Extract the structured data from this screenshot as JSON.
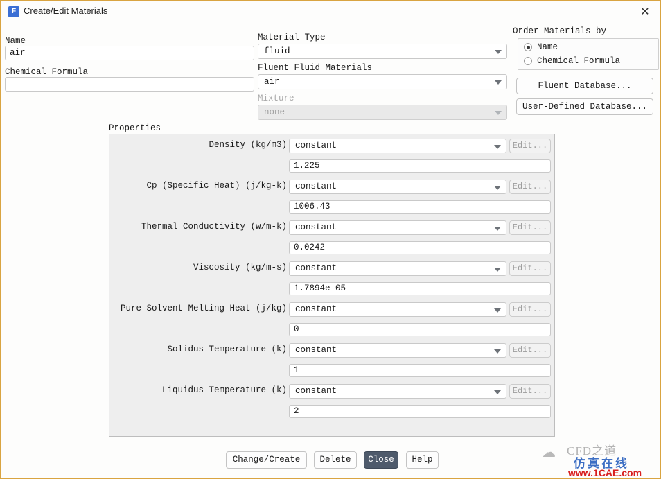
{
  "window": {
    "title": "Create/Edit Materials",
    "icon": "fluent-logo-icon",
    "icon_letter": "F",
    "close_label": "✕",
    "border_color": "#d9a441"
  },
  "left": {
    "name_label": "Name",
    "name_value": "air",
    "chemical_formula_label": "Chemical Formula",
    "chemical_formula_value": ""
  },
  "middle": {
    "material_type_label": "Material Type",
    "material_type_value": "fluid",
    "fluent_fluid_materials_label": "Fluent Fluid Materials",
    "fluent_fluid_materials_value": "air",
    "mixture_label": "Mixture",
    "mixture_value": "none",
    "mixture_disabled": true
  },
  "order": {
    "group_label": "Order Materials by",
    "options": [
      {
        "label": "Name",
        "selected": true
      },
      {
        "label": "Chemical Formula",
        "selected": false
      }
    ],
    "fluent_database_button": "Fluent Database...",
    "user_defined_database_button": "User-Defined Database..."
  },
  "properties": {
    "label": "Properties",
    "edit_button_label": "Edit...",
    "rows": [
      {
        "name": "Density (kg/m3)",
        "method": "constant",
        "value": "1.225"
      },
      {
        "name": "Cp (Specific Heat) (j/kg-k)",
        "method": "constant",
        "value": "1006.43"
      },
      {
        "name": "Thermal Conductivity (w/m-k)",
        "method": "constant",
        "value": "0.0242"
      },
      {
        "name": "Viscosity (kg/m-s)",
        "method": "constant",
        "value": "1.7894e-05"
      },
      {
        "name": "Pure Solvent Melting Heat (j/kg)",
        "method": "constant",
        "value": "0"
      },
      {
        "name": "Solidus Temperature (k)",
        "method": "constant",
        "value": "1"
      },
      {
        "name": "Liquidus Temperature (k)",
        "method": "constant",
        "value": "2"
      }
    ]
  },
  "footer": {
    "buttons": [
      {
        "label": "Change/Create",
        "primary": false
      },
      {
        "label": "Delete",
        "primary": false
      },
      {
        "label": "Close",
        "primary": true
      },
      {
        "label": "Help",
        "primary": false
      }
    ]
  },
  "watermark": {
    "cloud": "☁",
    "title": "CFD之道",
    "subtitle": "仿真在线",
    "url": "www.1CAE.com",
    "subtitle_color": "#3d6fc4",
    "url_color": "#d81e1e"
  }
}
